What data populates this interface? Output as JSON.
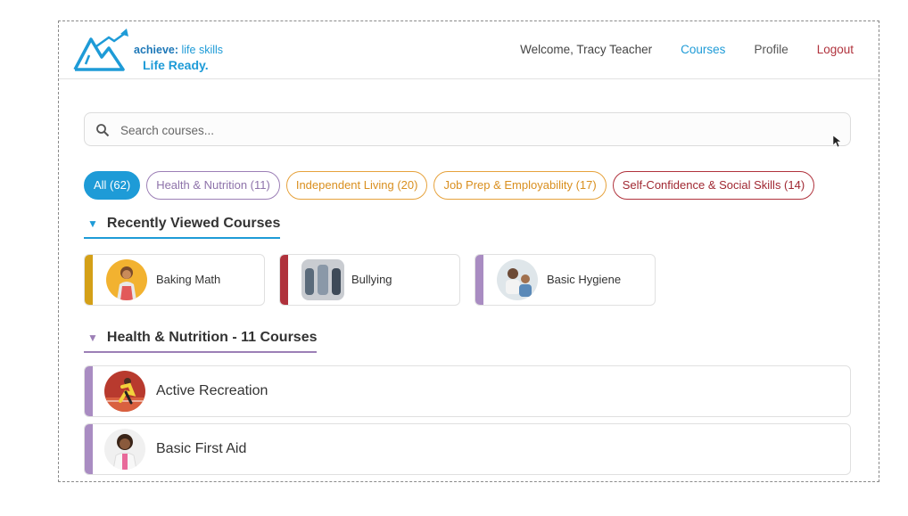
{
  "brand": {
    "line1_bold": "achieve:",
    "line1_rest": " life skills",
    "line2": "Life Ready."
  },
  "nav": {
    "welcome": "Welcome, Tracy Teacher",
    "courses": "Courses",
    "profile": "Profile",
    "logout": "Logout"
  },
  "search": {
    "placeholder": "Search courses...",
    "value": ""
  },
  "filters": [
    {
      "label": "All (62)",
      "selected": true
    },
    {
      "label": "Health & Nutrition (11)",
      "selected": false
    },
    {
      "label": "Independent Living (20)",
      "selected": false
    },
    {
      "label": "Job Prep & Employability (17)",
      "selected": false
    },
    {
      "label": "Self-Confidence & Social Skills (14)",
      "selected": false
    }
  ],
  "recent": {
    "title": "Recently Viewed Courses",
    "items": [
      {
        "title": "Baking Math",
        "accent": "#d4a017"
      },
      {
        "title": "Bullying",
        "accent": "#b0323c"
      },
      {
        "title": "Basic Hygiene",
        "accent": "#a98cc2"
      }
    ]
  },
  "health": {
    "title": "Health & Nutrition - 11 Courses",
    "items": [
      {
        "title": "Active Recreation"
      },
      {
        "title": "Basic First Aid"
      }
    ]
  },
  "colors": {
    "primary": "#1e9bd7",
    "health": "#9c7fb6",
    "living": "#e6a23c",
    "social": "#b0323c"
  }
}
